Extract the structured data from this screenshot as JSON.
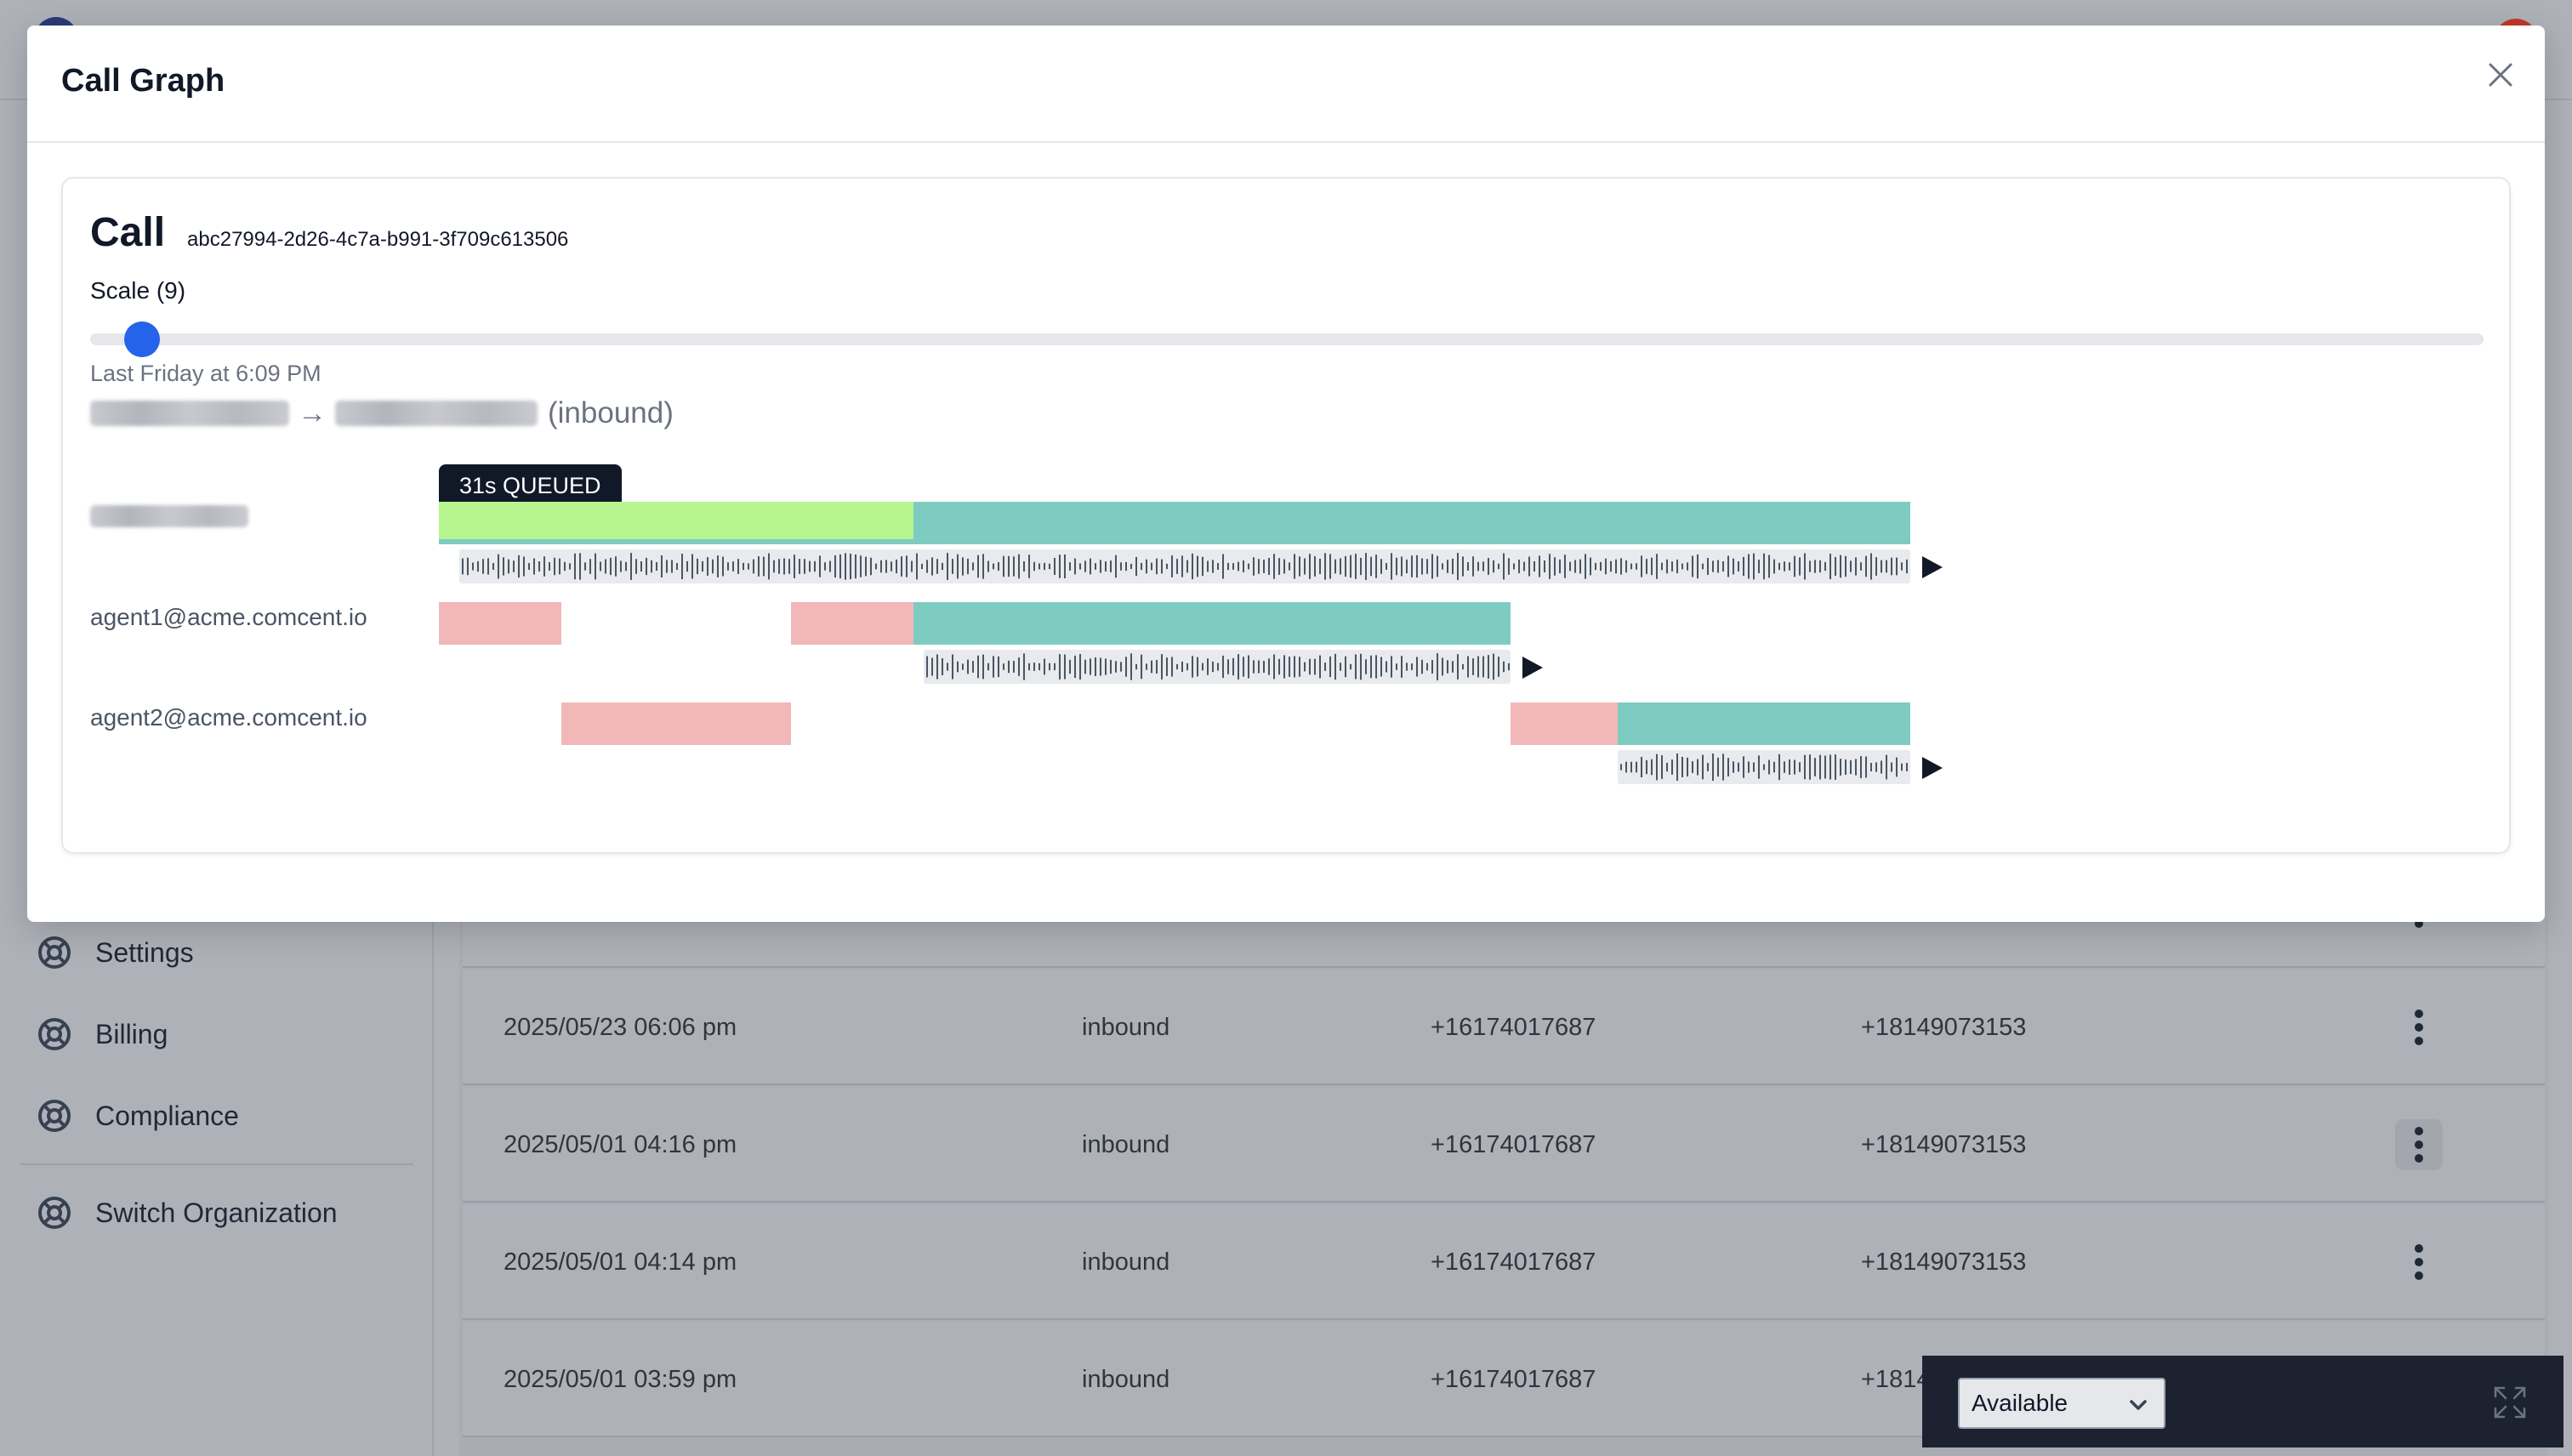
{
  "modal": {
    "title": "Call Graph",
    "call_word": "Call",
    "call_id": "abc27994-2d26-4c7a-b991-3f709c613506",
    "scale_label": "Scale (9)",
    "scale_value": 9,
    "timestamp": "Last Friday at 6:09 PM",
    "route_arrow": "→",
    "direction": "(inbound)",
    "tooltip": "31s QUEUED",
    "timeline": [
      {
        "label": "",
        "segments": [
          "queued",
          "talk"
        ]
      },
      {
        "label": "agent1@acme.comcent.io",
        "segments": [
          "ring",
          "ring",
          "talk"
        ]
      },
      {
        "label": "agent2@acme.comcent.io",
        "segments": [
          "ring",
          "ring",
          "talk"
        ]
      }
    ]
  },
  "sidebar": {
    "items": [
      {
        "label": "Settings",
        "icon": "lifebuoy-icon"
      },
      {
        "label": "Billing",
        "icon": "lifebuoy-icon"
      },
      {
        "label": "Compliance",
        "icon": "lifebuoy-icon"
      },
      {
        "label": "Switch Organization",
        "icon": "lifebuoy-icon"
      }
    ]
  },
  "table": {
    "rows": [
      {
        "date": "2025/05/23 06:06 pm",
        "direction": "inbound",
        "from": "+16174017687",
        "to": "+18149073153"
      },
      {
        "date": "2025/05/01 04:16 pm",
        "direction": "inbound",
        "from": "+16174017687",
        "to": "+18149073153"
      },
      {
        "date": "2025/05/01 04:14 pm",
        "direction": "inbound",
        "from": "+16174017687",
        "to": "+18149073153"
      },
      {
        "date": "2025/05/01 03:59 pm",
        "direction": "inbound",
        "from": "+16174017687",
        "to": "+1814"
      }
    ]
  },
  "dock": {
    "status": "Available"
  },
  "colors": {
    "queued": "#b7f58e",
    "talk": "#7ecbc2",
    "ring": "#f2b8b8",
    "accent": "#2563eb"
  }
}
